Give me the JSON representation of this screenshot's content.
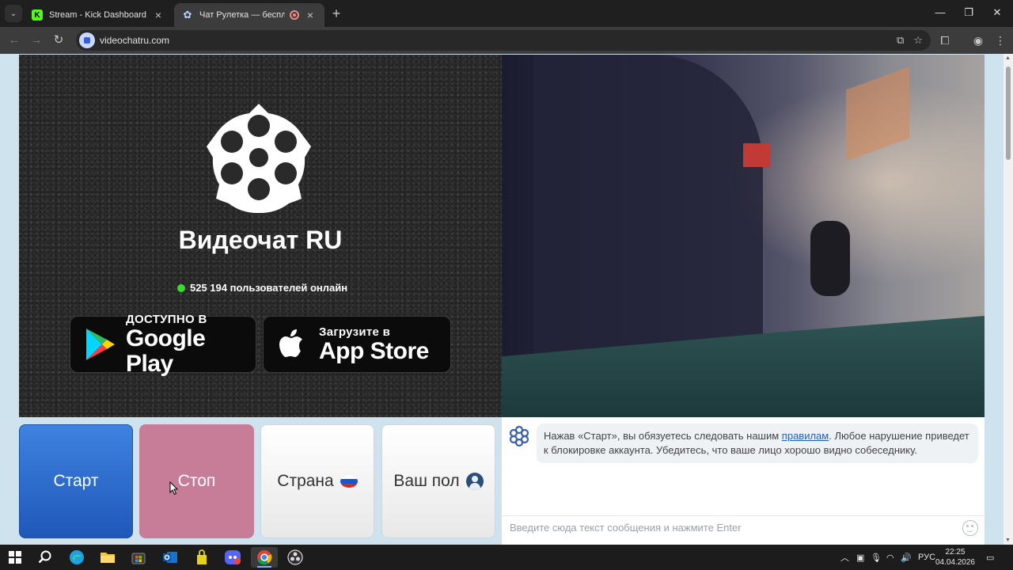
{
  "browser": {
    "tabs": [
      {
        "title": "Stream - Kick Dashboard",
        "favicon": "kick-icon"
      },
      {
        "title": "Чат Рулетка — бесплатный",
        "favicon": "roulette-icon"
      }
    ],
    "url": "videochatru.com"
  },
  "site": {
    "brand": "Видеочат RU",
    "online_text": "525 194 пользователей онлайн",
    "google_play": {
      "small": "ДОСТУПНО В",
      "big": "Google Play"
    },
    "app_store": {
      "small": "Загрузите в",
      "big": "App Store"
    }
  },
  "controls": {
    "start": "Старт",
    "stop": "Стоп",
    "country": "Страна",
    "gender": "Ваш пол"
  },
  "chat": {
    "message_before": "Нажав «Старт», вы обязуетесь следовать нашим ",
    "message_link": "правилам",
    "message_after": ". Любое нарушение приведет к блокировке аккаунта. Убедитесь, что ваше лицо хорошо видно собеседнику.",
    "input_placeholder": "Введите сюда текст сообщения и нажмите Enter"
  },
  "taskbar": {
    "language": "РУС",
    "time": "22:25",
    "date": "04.04.2026"
  },
  "colors": {
    "start": "#2d6fd0",
    "stop": "#c77d97",
    "online_dot": "#3ddc2c",
    "page_bg": "#cfe3ee"
  }
}
